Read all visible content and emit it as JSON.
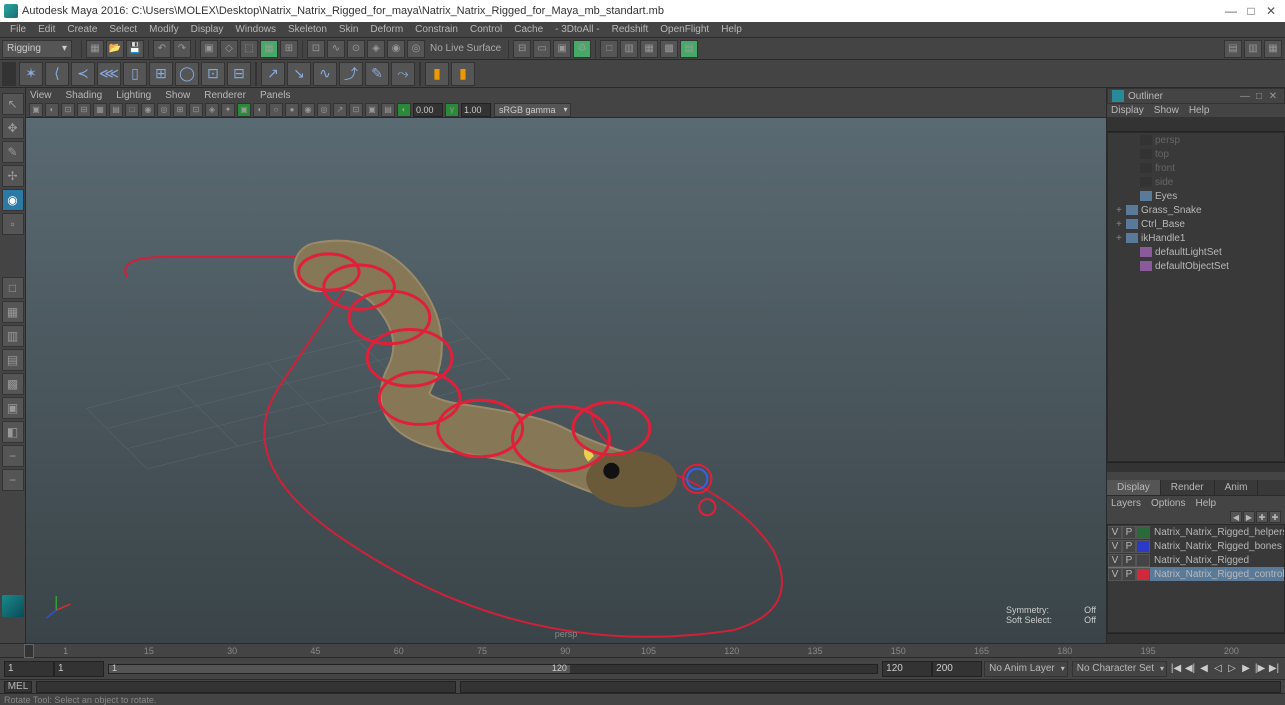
{
  "title": "Autodesk Maya 2016: C:\\Users\\MOLEX\\Desktop\\Natrix_Natrix_Rigged_for_maya\\Natrix_Natrix_Rigged_for_Maya_mb_standart.mb",
  "menubar": [
    "File",
    "Edit",
    "Create",
    "Select",
    "Modify",
    "Display",
    "Windows",
    "Skeleton",
    "Skin",
    "Deform",
    "Constrain",
    "Control",
    "Cache",
    "- 3DtoAll -",
    "Redshift",
    "OpenFlight",
    "Help"
  ],
  "workspace_dropdown": "Rigging",
  "no_live_surface": "No Live Surface",
  "panel_menu": [
    "View",
    "Shading",
    "Lighting",
    "Show",
    "Renderer",
    "Panels"
  ],
  "exposure": "0.00",
  "gamma": "1.00",
  "colorspace": "sRGB gamma",
  "camera_label": "persp",
  "symmetry_label": "Symmetry:",
  "symmetry_value": "Off",
  "softselect_label": "Soft Select:",
  "softselect_value": "Off",
  "outliner": {
    "title": "Outliner",
    "menu": [
      "Display",
      "Show",
      "Help"
    ],
    "items": [
      {
        "name": "persp",
        "type": "cam",
        "dim": true,
        "indent": 1
      },
      {
        "name": "top",
        "type": "cam",
        "dim": true,
        "indent": 1
      },
      {
        "name": "front",
        "type": "cam",
        "dim": true,
        "indent": 1
      },
      {
        "name": "side",
        "type": "cam",
        "dim": true,
        "indent": 1
      },
      {
        "name": "Eyes",
        "type": "obj",
        "dim": false,
        "indent": 1,
        "exp": ""
      },
      {
        "name": "Grass_Snake",
        "type": "obj",
        "dim": false,
        "indent": 0,
        "exp": "+"
      },
      {
        "name": "Ctrl_Base",
        "type": "obj",
        "dim": false,
        "indent": 0,
        "exp": "+"
      },
      {
        "name": "ikHandle1",
        "type": "obj",
        "dim": false,
        "indent": 0,
        "exp": "+"
      },
      {
        "name": "defaultLightSet",
        "type": "set",
        "dim": false,
        "indent": 1,
        "exp": ""
      },
      {
        "name": "defaultObjectSet",
        "type": "set",
        "dim": false,
        "indent": 1,
        "exp": ""
      }
    ]
  },
  "display_tabs": [
    "Display",
    "Render",
    "Anim"
  ],
  "layer_menu": [
    "Layers",
    "Options",
    "Help"
  ],
  "layers": [
    {
      "v": "V",
      "p": "P",
      "color": "#2a6a3a",
      "name": "Natrix_Natrix_Rigged_helpers",
      "sel": false
    },
    {
      "v": "V",
      "p": "P",
      "color": "#2a3aca",
      "name": "Natrix_Natrix_Rigged_bones",
      "sel": false
    },
    {
      "v": "V",
      "p": "P",
      "color": "#444",
      "name": "Natrix_Natrix_Rigged",
      "sel": false
    },
    {
      "v": "V",
      "p": "P",
      "color": "#d02a3a",
      "name": "Natrix_Natrix_Rigged_controllers",
      "sel": true
    }
  ],
  "timeline_ticks": [
    "1",
    "15",
    "30",
    "45",
    "60",
    "75",
    "90",
    "105",
    "120",
    "135",
    "150",
    "165",
    "180",
    "195",
    "200"
  ],
  "range": {
    "start_outer": "1",
    "start": "1",
    "cur": "1",
    "end": "120",
    "end_outer": "120",
    "end2": "200"
  },
  "anim_layer": "No Anim Layer",
  "char_set": "No Character Set",
  "cmd_lang": "MEL",
  "helpline": "Rotate Tool: Select an object to rotate."
}
